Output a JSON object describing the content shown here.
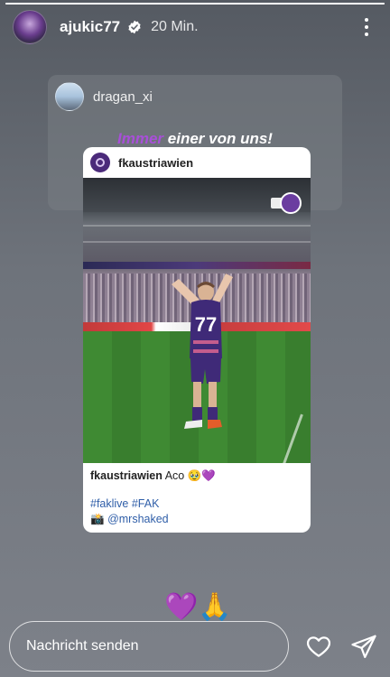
{
  "story": {
    "username": "ajukic77",
    "time": "20 Min.",
    "progress": 1.0
  },
  "repost": {
    "username": "dragan_xi",
    "tagline_accent": "Immer",
    "tagline_rest": " einer von uns!"
  },
  "post": {
    "handle": "fkaustriawien",
    "image_alt_player_number": "77",
    "caption_user": "fkaustriawien",
    "caption_text": "Aco",
    "caption_emoji": "🥹💜",
    "hashtags": "#faklive #FAK",
    "mention_prefix": "📸",
    "mention": "@mrshaked"
  },
  "reactions": {
    "emoji": "💜🙏"
  },
  "reply": {
    "placeholder": "Nachricht senden"
  },
  "colors": {
    "accent_purple": "#a84fd8",
    "link_blue": "#2f5ea8"
  },
  "icons": {
    "verified": "verified-badge-icon",
    "more": "more-vertical-icon",
    "like": "heart-outline-icon",
    "send": "paper-plane-icon"
  }
}
